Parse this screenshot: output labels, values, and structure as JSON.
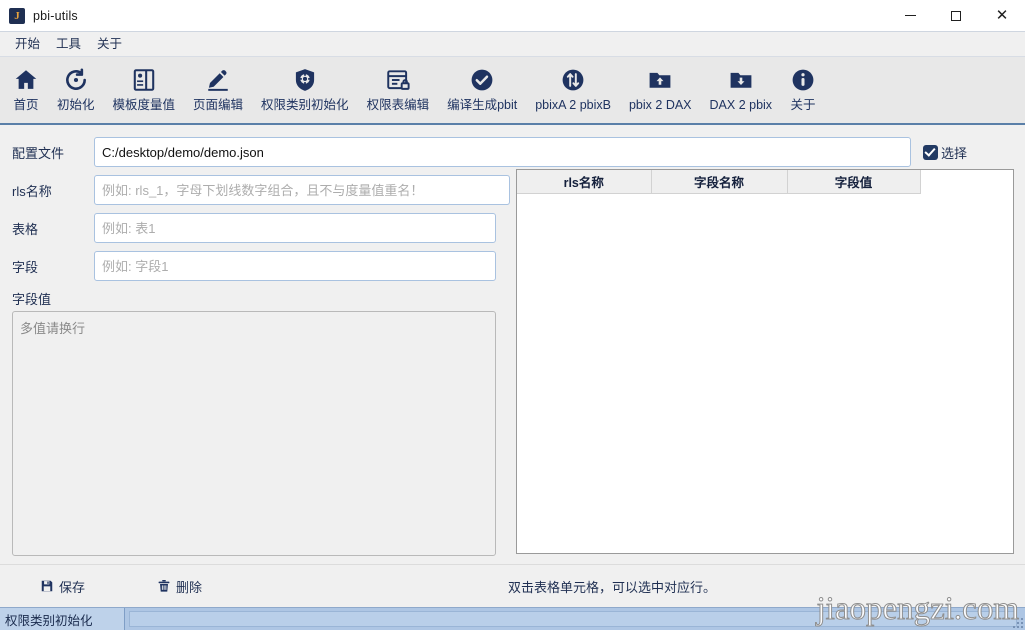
{
  "window": {
    "title": "pbi-utils",
    "app_icon_letter": "J",
    "controls": {
      "minimize": "minimize-icon",
      "maximize": "maximize-icon",
      "close": "close-icon"
    }
  },
  "menubar": {
    "items": [
      {
        "label": "开始",
        "name": "menu-start"
      },
      {
        "label": "工具",
        "name": "menu-tools"
      },
      {
        "label": "关于",
        "name": "menu-about"
      }
    ]
  },
  "toolbar": {
    "items": [
      {
        "label": "首页",
        "icon": "home-icon"
      },
      {
        "label": "初始化",
        "icon": "refresh-icon"
      },
      {
        "label": "模板度量值",
        "icon": "template-icon"
      },
      {
        "label": "页面编辑",
        "icon": "pencil-icon"
      },
      {
        "label": "权限类别初始化",
        "icon": "shield-gear-icon"
      },
      {
        "label": "权限表编辑",
        "icon": "table-lock-icon"
      },
      {
        "label": "编译生成pbit",
        "icon": "check-circle-icon"
      },
      {
        "label": "pbixA 2 pbixB",
        "icon": "transfer-circle-icon"
      },
      {
        "label": "pbix 2 DAX",
        "icon": "folder-up-icon"
      },
      {
        "label": "DAX 2 pbix",
        "icon": "folder-down-icon"
      },
      {
        "label": "关于",
        "icon": "info-circle-icon"
      }
    ]
  },
  "form": {
    "config_file": {
      "label": "配置文件",
      "value": "C:/desktop/demo/demo.json",
      "placeholder": ""
    },
    "rls_name": {
      "label": "rls名称",
      "value": "",
      "placeholder": "例如: rls_1，字母下划线数字组合，且不与度量值重名！"
    },
    "table": {
      "label": "表格",
      "value": "",
      "placeholder": "例如: 表1"
    },
    "field": {
      "label": "字段",
      "value": "",
      "placeholder": "例如: 字段1"
    },
    "field_value": {
      "label": "字段值",
      "value": "",
      "placeholder": "多值请换行"
    },
    "select_checkbox": {
      "label": "选择",
      "checked": true
    }
  },
  "grid": {
    "columns": [
      "rls名称",
      "字段名称",
      "字段值"
    ],
    "rows": []
  },
  "footer": {
    "save": {
      "label": "保存",
      "icon": "save-icon"
    },
    "delete": {
      "label": "删除",
      "icon": "trash-icon"
    },
    "hint": "双击表格单元格，可以选中对应行。"
  },
  "statusbar": {
    "section": "权限类别初始化",
    "progress_text": ""
  },
  "watermark": "jiaopengzi.com",
  "colors": {
    "accent": "#1f3360",
    "toolbar_bg": "#e8e8e8",
    "toolbar_rule": "#5a7fa8",
    "status_bg": "#aec6e4",
    "icon_gold": "#e8a33d"
  }
}
